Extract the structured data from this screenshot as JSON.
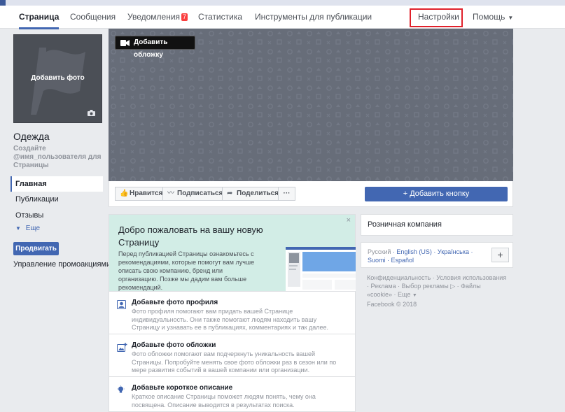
{
  "nav": {
    "items": [
      {
        "label": "Страница",
        "active": true
      },
      {
        "label": "Сообщения"
      },
      {
        "label": "Уведомления",
        "badge": "7"
      },
      {
        "label": "Статистика"
      },
      {
        "label": "Инструменты для публикации"
      },
      {
        "label": "Настройки",
        "highlighted": true
      },
      {
        "label": "Помощь"
      }
    ]
  },
  "profile": {
    "add_photo_label": "Добавить фото",
    "page_name": "Одежда",
    "username_prompt": "Создайте @имя_пользователя для Страницы"
  },
  "left_nav": {
    "items": [
      {
        "label": "Главная",
        "active": true
      },
      {
        "label": "Публикации"
      },
      {
        "label": "Отзывы"
      },
      {
        "label": "Еще"
      }
    ],
    "promote_label": "Продвигать",
    "promotions_link": "Управление промоакциями"
  },
  "cover": {
    "add_cover_label": "Добавить обложку"
  },
  "actions": {
    "like": "Нравится",
    "follow": "Подписаться",
    "share": "Поделиться",
    "more": "···",
    "add_button": "+ Добавить кнопку"
  },
  "welcome": {
    "title": "Добро пожаловать на вашу новую Страницу",
    "description": "Перед публикацией Страницы ознакомьтесь с рекомендациями, которые помогут вам лучше описать свою компанию, бренд или организацию. Позже мы дадим вам больше рекомендаций.",
    "close": "×",
    "tasks": [
      {
        "title": "Добавьте фото профиля",
        "description": "Фото профиля помогают вам придать вашей Странице индивидуальность. Они также помогают людям находить вашу Страницу и узнавать ее в публикациях, комментариях и так далее.",
        "icon": "profile-photo-icon"
      },
      {
        "title": "Добавьте фото обложки",
        "description": "Фото обложки помогают вам подчеркнуть уникальность вашей Страницы. Попробуйте менять свое фото обложки раз в сезон или по мере развития событий в вашей компании или организации.",
        "icon": "cover-photo-icon"
      },
      {
        "title": "Добавьте короткое описание",
        "description": "Краткое описание Страницы поможет людям понять, чему она посвящена. Описание выводится в результатах поиска.",
        "icon": "lightbulb-icon"
      }
    ]
  },
  "sidebar": {
    "category": "Розничная компания",
    "languages": {
      "current": "Русский",
      "others": [
        "English (US)",
        "Українська",
        "Suomi",
        "Español"
      ],
      "add": "+"
    },
    "footer": {
      "privacy": "Конфиденциальность",
      "terms": "Условия использования",
      "ads": "Реклама",
      "ad_choices": "Выбор рекламы",
      "cookies": "Файлы «cookie»",
      "more": "Еще",
      "copyright": "Facebook © 2018"
    }
  },
  "colors": {
    "accent": "#4267b2",
    "highlight_border": "#e0202a",
    "cover_bg": "#676d79",
    "welcome_bg": "#d2ede6"
  }
}
